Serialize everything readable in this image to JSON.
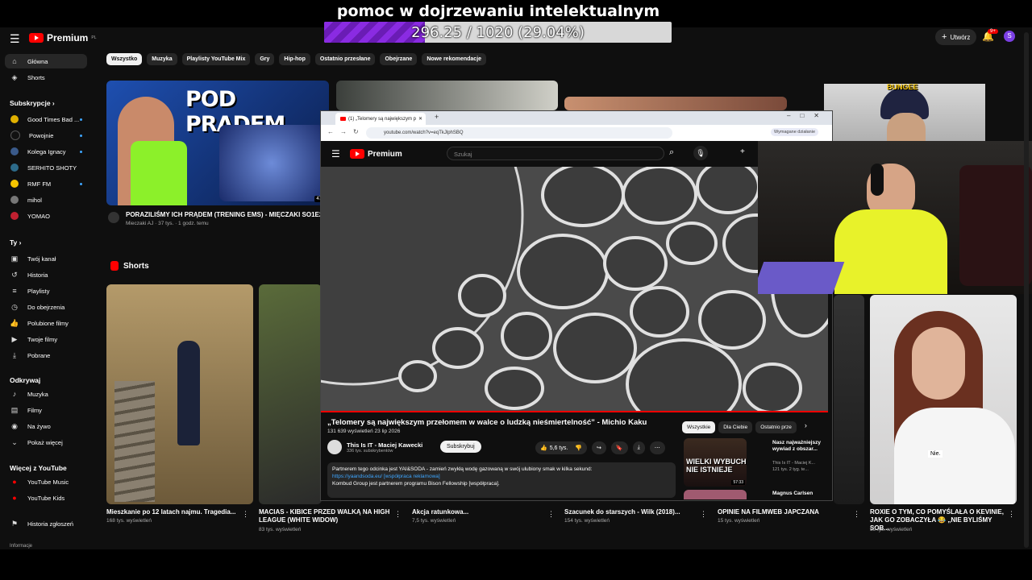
{
  "goal": {
    "title": "pomoc w dojrzewaniu intelektualnym",
    "progress_text": "296.25 / 1020 (29.04%)",
    "progress": 0.2904
  },
  "header": {
    "logo": "Premium",
    "logo_sup": "PL",
    "create_label": "Utwórz",
    "notif_count": "9+",
    "avatar_letter": "S"
  },
  "chips": [
    "Wszystko",
    "Muzyka",
    "Playlisty YouTube Mix",
    "Gry",
    "Hip-hop",
    "Ostatnio przesłane",
    "Obejrzane",
    "Nowe rekomendacje"
  ],
  "sidebar": {
    "top": [
      {
        "label": "Główna",
        "icon": "home-icon"
      },
      {
        "label": "Shorts",
        "icon": "shorts-icon"
      }
    ],
    "subs_header": "Subskrypcje",
    "subs": [
      {
        "label": "Good Times Bad ...",
        "color": "#e0b000"
      },
      {
        "label": "Powojnie",
        "color": "#111111"
      },
      {
        "label": "Kolega Ignacy",
        "color": "#3a5a8a"
      },
      {
        "label": "SERHITO SHOTY",
        "color": "#2d6b8a"
      },
      {
        "label": "RMF FM",
        "color": "#f5c400"
      },
      {
        "label": "mihol",
        "color": "#777777"
      },
      {
        "label": "YOMAO",
        "color": "#c02030"
      }
    ],
    "you_header": "Ty",
    "you": [
      {
        "label": "Twój kanał",
        "icon": "channel-icon"
      },
      {
        "label": "Historia",
        "icon": "history-icon"
      },
      {
        "label": "Playlisty",
        "icon": "playlist-icon"
      },
      {
        "label": "Do obejrzenia",
        "icon": "clock-icon"
      },
      {
        "label": "Polubione filmy",
        "icon": "like-icon"
      },
      {
        "label": "Twoje filmy",
        "icon": "video-icon"
      },
      {
        "label": "Pobrane",
        "icon": "download-icon"
      }
    ],
    "explore_header": "Odkrywaj",
    "explore": [
      {
        "label": "Muzyka",
        "icon": "music-icon"
      },
      {
        "label": "Filmy",
        "icon": "film-icon"
      },
      {
        "label": "Na żywo",
        "icon": "live-icon"
      },
      {
        "label": "Pokaż więcej",
        "icon": "chevron-down-icon"
      }
    ],
    "more_header": "Więcej z YouTube",
    "more": [
      {
        "label": "YouTube Music",
        "icon": "yt-music-icon"
      },
      {
        "label": "YouTube Kids",
        "icon": "yt-kids-icon"
      }
    ],
    "report": "Historia zgłoszeń",
    "info": "Informacje"
  },
  "feature": {
    "thumb_text": "POD PRĄDEM",
    "duration": "47:3",
    "title": "PORAZILIŚMY ICH PRĄDEM (TRENING EMS) - MIĘCZAKI SO1E23",
    "channel": "Mieczaki AJ",
    "meta": "37 tys. · 1 godz. temu"
  },
  "shorts_header": "Shorts",
  "shorts": [
    {
      "title": "Mieszkanie po 12 latach najmu. Tragedia...",
      "views": "168 tys. wyświetleń"
    },
    {
      "title": "MACIAS - KIBICE PRZED WALKĄ NA HIGH LEAGUE (WHITE WIDOW)",
      "views": "83 tys. wyświetleń"
    },
    {
      "title": "Akcja ratunkowa...",
      "views": "7,5 tys. wyświetleń"
    },
    {
      "title": "Szacunek do starszych - Wilk (2018)...",
      "views": "154 tys. wyświetleń"
    },
    {
      "title": "OPINIE NA FILMWEB JAPCZANA",
      "views": "15 tys. wyświetleń"
    },
    {
      "title": "ROXIE O TYM, CO POMYŚLAŁA O KEVINIE, JAK GO ZOBACZYŁA 😂 „NIE BYLIŚMY SOB...",
      "views": "89 tys. wyświetleń"
    }
  ],
  "browser": {
    "tab_title": "(1) „Telomery są największym p",
    "url": "youtube.com/watch?v=eqTkJlphSBQ",
    "wymagane": "Wymagane działanie",
    "search_placeholder": "Szukaj",
    "video_title": "„Telomery są największym przełomem w walce o ludzką nieśmiertelność” - Michio Kaku",
    "video_meta": "131 639 wyświetleń  23 lip 2026",
    "channel": "This Is IT - Maciej Kawecki",
    "subs": "336 tys. subskrybentów",
    "subscribe": "Subskrybuj",
    "likes": "5,6 tys.",
    "desc": [
      "Partnerem tego odcinka jest YAI&SODA - zamień zwykłą wodę gazowaną w swój ulubiony smak w kilka sekund:",
      "https://yaandsoda.eu/ [współpraca reklamowa]",
      "Kombud Group jest partnerem programu Bison Fellowship [współpraca]."
    ],
    "side_chips": [
      "Wszystkie",
      "Dla Ciebie",
      "Ostatnio prze"
    ],
    "side_video": {
      "title": "Nasz najważniejszy wywiad z obszar...",
      "channel": "This Is IT - Maciej K...",
      "meta": "121 tys.  2 tyg. te...",
      "thumb_text": "WIELKI WYBUCH NIE ISTNIEJE",
      "duration": "57:33"
    },
    "side_video2": {
      "title": "Magnus Carlsen"
    }
  },
  "cam_top": {
    "hat_text": "BUNGEE"
  },
  "roxie": {
    "shirt_text": "Nie."
  }
}
